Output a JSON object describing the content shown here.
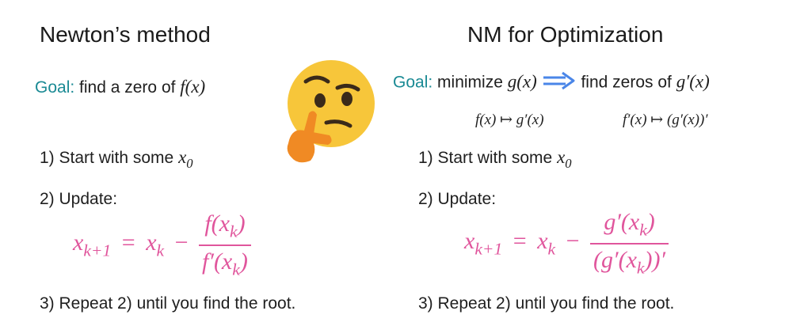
{
  "left": {
    "title": "Newton’s method",
    "goal_label": "Goal:",
    "goal_text": "find a zero of",
    "goal_fn": "f(x)",
    "step1_text": "1) Start with some",
    "step1_var": "x",
    "step1_sub": "0",
    "step2_text": "2) Update:",
    "lhs_var": "x",
    "lhs_sub": "k+1",
    "eq": "=",
    "rhs_var": "x",
    "rhs_sub": "k",
    "minus": "−",
    "num_pre": "f(x",
    "num_sub": "k",
    "num_post": ")",
    "den_pre": "f′(x",
    "den_sub": "k",
    "den_post": ")",
    "step3_text": "3) Repeat 2) until you find the root."
  },
  "right": {
    "title": "NM for Optimization",
    "goal_label": "Goal:",
    "goal_text1": "minimize",
    "goal_fn1": "g(x)",
    "goal_text2": "find zeros of",
    "goal_fn2": "g′(x)",
    "map1": "f(x) ↦ g′(x)",
    "map2": "f′(x) ↦ (g′(x))′",
    "step1_text": "1) Start with some",
    "step1_var": "x",
    "step1_sub": "0",
    "step2_text": "2) Update:",
    "lhs_var": "x",
    "lhs_sub": "k+1",
    "eq": "=",
    "rhs_var": "x",
    "rhs_sub": "k",
    "minus": "−",
    "num_pre": "g′(x",
    "num_sub": "k",
    "num_post": ")",
    "den_pre": "(g′(x",
    "den_sub": "k",
    "den_post": "))′",
    "step3_text": "3) Repeat 2) until you find the root."
  },
  "icons": {
    "thinking": "thinking-face-emoji",
    "arrow": "double-right-arrow",
    "arrow_color": "#4a86e8",
    "emoji_face_color": "#f7c63a",
    "emoji_hand_color": "#f08a24"
  },
  "colors": {
    "goal": "#1a8a94",
    "formula": "#e0559c"
  }
}
